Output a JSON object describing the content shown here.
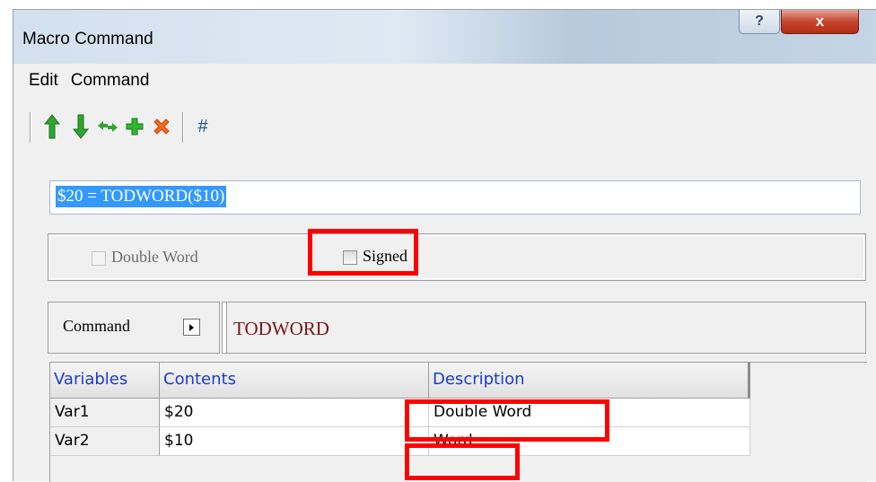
{
  "window": {
    "title": "Macro Command",
    "help_label": "?",
    "close_label": "x"
  },
  "menu": [
    "Edit",
    "Command"
  ],
  "toolbar": {
    "icons": [
      "move-up-icon",
      "move-down-icon",
      "replace-icon",
      "add-icon",
      "delete-icon",
      "hash-icon"
    ],
    "hash_label": "#"
  },
  "command_line": "$20 = TODWORD($10)",
  "options": {
    "double_word_label": "Double Word",
    "signed_label": "Signed"
  },
  "command_selector": {
    "label": "Command",
    "value": "TODWORD"
  },
  "table": {
    "headers": [
      "Variables",
      "Contents",
      "Description"
    ],
    "rows": [
      {
        "variable": "Var1",
        "contents": "$20",
        "description": "Double Word"
      },
      {
        "variable": "Var2",
        "contents": "$10",
        "description": "Word"
      }
    ]
  },
  "colors": {
    "highlight": "#ff0000",
    "selection": "#3399ff",
    "header_text": "#1b3ccf"
  }
}
